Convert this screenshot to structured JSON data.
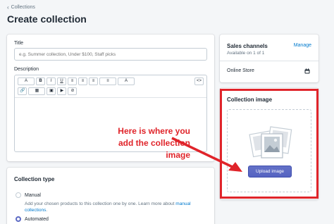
{
  "breadcrumb": {
    "label": "Collections"
  },
  "page": {
    "title": "Create collection"
  },
  "form": {
    "title_label": "Title",
    "title_placeholder": "e.g. Summer collection, Under $100, Staff picks",
    "description_label": "Description",
    "toolbar": {
      "row1": [
        "A",
        "B",
        "I",
        "U",
        "≡",
        "≡",
        "≡",
        "≡",
        "A"
      ],
      "row2": [
        "🔗",
        "▦",
        "▣",
        "▶",
        "⊘"
      ],
      "code": "<>"
    }
  },
  "collection_type": {
    "title": "Collection type",
    "manual_label": "Manual",
    "manual_helper": "Add your chosen products to this collection one by one. Learn more about ",
    "manual_link": "manual collections",
    "automated_label": "Automated"
  },
  "sales_channels": {
    "title": "Sales channels",
    "manage": "Manage",
    "available": "Available on 1 of 1",
    "store": "Online Store"
  },
  "collection_image": {
    "title": "Collection image",
    "upload_label": "Upload image"
  },
  "annotation": {
    "callout": "Here is where you add the collection image",
    "color": "#e0242a"
  },
  "colors": {
    "accent": "#5c6ac4",
    "link": "#007ace"
  }
}
